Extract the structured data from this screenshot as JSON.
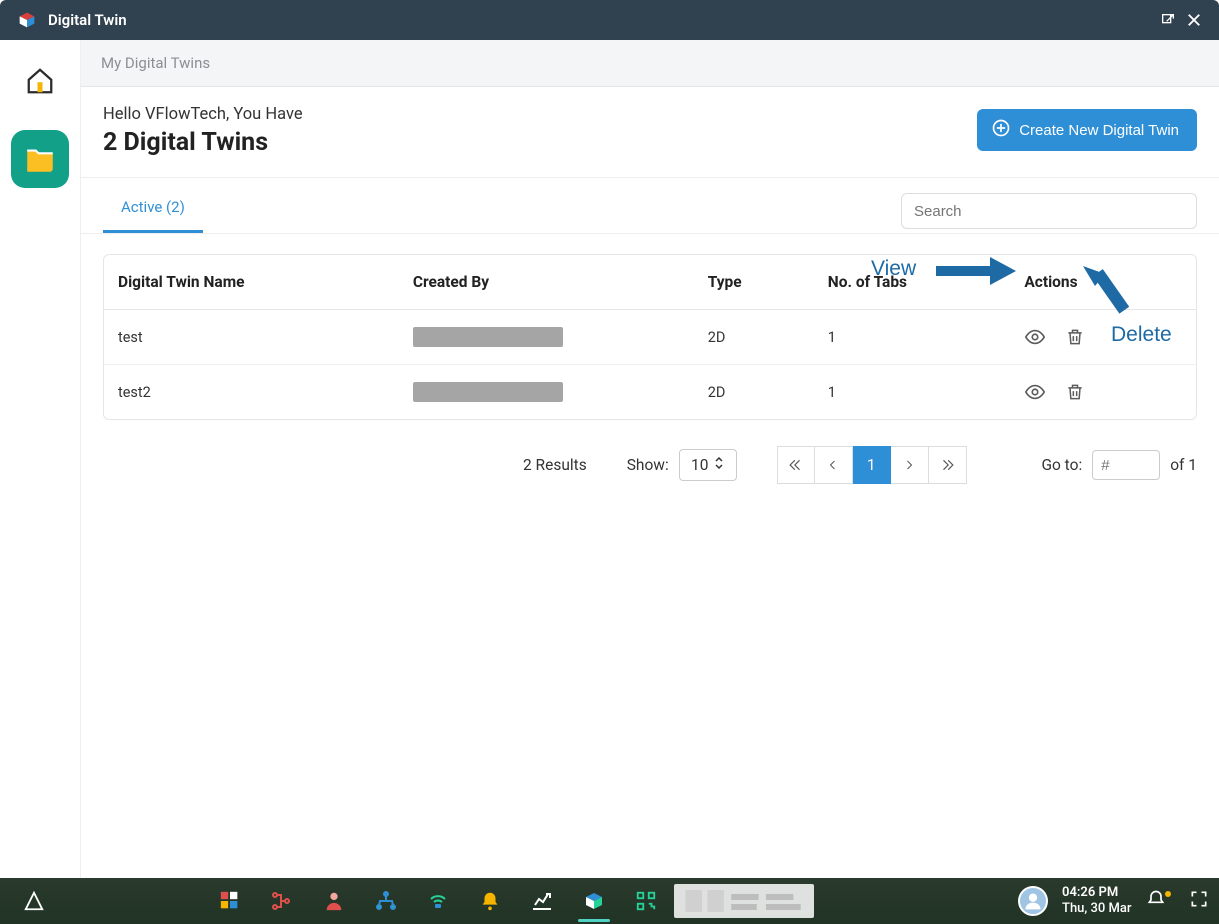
{
  "titlebar": {
    "app_name": "Digital Twin"
  },
  "breadcrumb": "My Digital Twins",
  "header": {
    "greeting": "Hello VFlowTech, You Have",
    "title": "2 Digital Twins",
    "create_button": "Create New Digital Twin"
  },
  "tabs": {
    "active_label": "Active (2)"
  },
  "search": {
    "placeholder": "Search",
    "value": ""
  },
  "table": {
    "headers": {
      "name": "Digital Twin Name",
      "created_by": "Created By",
      "type": "Type",
      "tabs": "No. of Tabs",
      "actions": "Actions"
    },
    "rows": [
      {
        "name": "test",
        "type": "2D",
        "tabs": "1"
      },
      {
        "name": "test2",
        "type": "2D",
        "tabs": "1"
      }
    ]
  },
  "annotations": {
    "view": "View",
    "delete": "Delete"
  },
  "pagination": {
    "results_text": "2 Results",
    "show_label": "Show:",
    "show_value": "10",
    "current_page": "1",
    "goto_label": "Go to:",
    "goto_placeholder": "#",
    "of_text": "of 1"
  },
  "taskbar": {
    "time": "04:26 PM",
    "date": "Thu, 30 Mar"
  }
}
